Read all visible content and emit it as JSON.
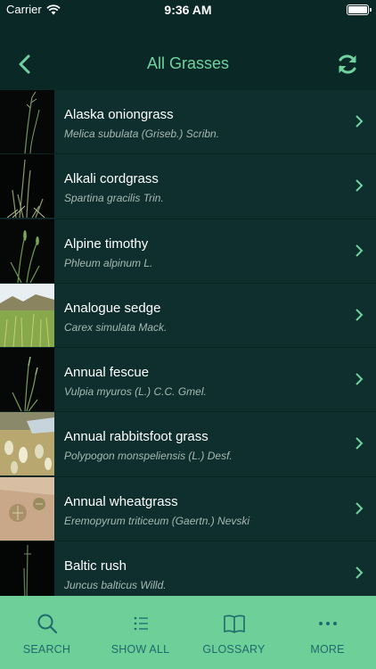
{
  "status_bar": {
    "carrier": "Carrier",
    "time": "9:36 AM"
  },
  "nav": {
    "title": "All Grasses",
    "back_icon": "chevron-left-icon",
    "refresh_icon": "refresh-icon"
  },
  "colors": {
    "accent": "#6fd3a0",
    "tab_bar": "#6fcf98",
    "tab_label": "#1d6b6e",
    "background": "#0c2a28"
  },
  "grasses": [
    {
      "common": "Alaska oniongrass",
      "scientific": "Melica subulata (Griseb.) Scribn."
    },
    {
      "common": "Alkali cordgrass",
      "scientific": "Spartina gracilis Trin."
    },
    {
      "common": "Alpine timothy",
      "scientific": "Phleum alpinum L."
    },
    {
      "common": "Analogue sedge",
      "scientific": "Carex simulata Mack."
    },
    {
      "common": "Annual fescue",
      "scientific": "Vulpia myuros (L.) C.C. Gmel."
    },
    {
      "common": "Annual rabbitsfoot grass",
      "scientific": "Polypogon monspeliensis (L.) Desf."
    },
    {
      "common": "Annual wheatgrass",
      "scientific": "Eremopyrum triticeum (Gaertn.) Nevski"
    },
    {
      "common": "Baltic rush",
      "scientific": "Juncus balticus Willd."
    }
  ],
  "tabs": [
    {
      "label": "SEARCH",
      "icon": "search-icon"
    },
    {
      "label": "SHOW ALL",
      "icon": "list-icon"
    },
    {
      "label": "GLOSSARY",
      "icon": "book-icon"
    },
    {
      "label": "MORE",
      "icon": "more-icon"
    }
  ]
}
